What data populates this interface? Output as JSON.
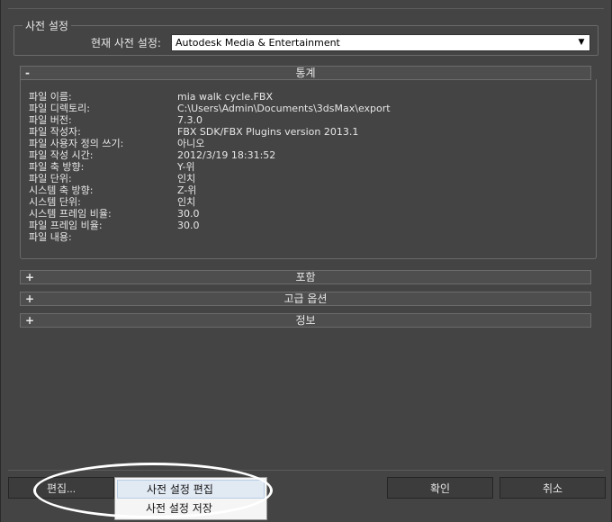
{
  "preset": {
    "group_label": "사전 설정",
    "current_label": "현재 사전 설정:",
    "current_value": "Autodesk Media & Entertainment"
  },
  "rollouts": {
    "stats": {
      "sign": "-",
      "title": "통계"
    },
    "include": {
      "sign": "+",
      "title": "포함"
    },
    "advanced": {
      "sign": "+",
      "title": "고급 옵션"
    },
    "info": {
      "sign": "+",
      "title": "정보"
    }
  },
  "stats": [
    {
      "label": "파일 이름:",
      "value": "mia walk cycle.FBX"
    },
    {
      "label": "파일 디렉토리:",
      "value": "C:\\Users\\Admin\\Documents\\3dsMax\\export"
    },
    {
      "label": "파일 버전:",
      "value": "7.3.0"
    },
    {
      "label": "파일 작성자:",
      "value": "FBX SDK/FBX Plugins version 2013.1"
    },
    {
      "label": "파일 사용자 정의 쓰기:",
      "value": "아니오"
    },
    {
      "label": "파일 작성 시간:",
      "value": "2012/3/19  18:31:52"
    },
    {
      "label": "파일 축 방향:",
      "value": "Y-위"
    },
    {
      "label": "파일 단위:",
      "value": "인치"
    },
    {
      "label": "시스템 축 방향:",
      "value": "Z-위"
    },
    {
      "label": "시스템 단위:",
      "value": "인치"
    },
    {
      "label": "시스템 프레임 비율:",
      "value": "30.0"
    },
    {
      "label": "파일 프레임 비율:",
      "value": "30.0"
    },
    {
      "label": "파일 내용:",
      "value": ""
    }
  ],
  "buttons": {
    "edit": "편집...",
    "ok": "확인",
    "cancel": "취소"
  },
  "menu": {
    "edit_preset": "사전 설정 편집",
    "save_preset": "사전 설정 저장"
  },
  "icons": {
    "dropdown_arrow": "dropdown-arrow-icon"
  }
}
